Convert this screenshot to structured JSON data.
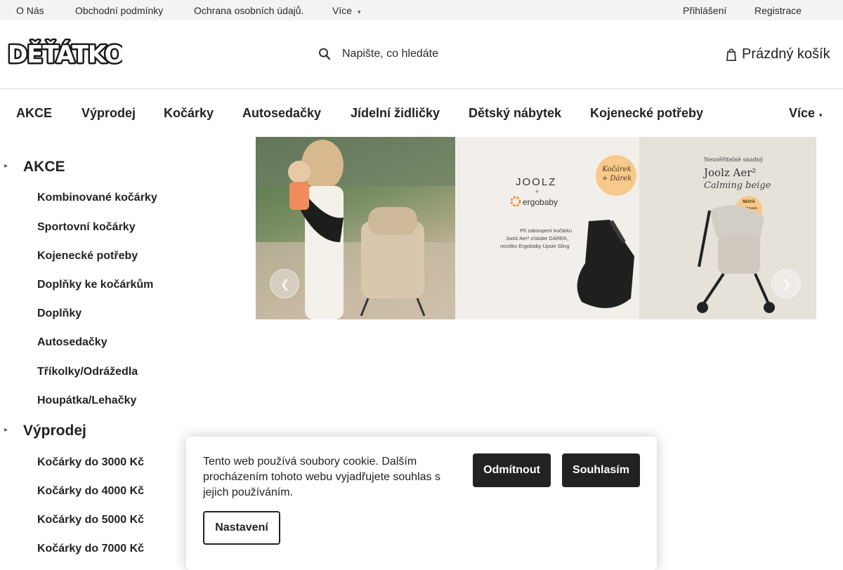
{
  "topbar": {
    "links": [
      "O Nás",
      "Obchodní podmínky",
      "Ochrana osobních údajů.",
      "Více"
    ],
    "login": "Přihlášení",
    "register": "Registrace"
  },
  "header": {
    "logo_text": "DĚŤÁTKO",
    "search_placeholder": "Napište, co hledáte",
    "cart_label": "Prázdný košík"
  },
  "mainnav": {
    "items": [
      "AKCE",
      "Výprodej",
      "Kočárky",
      "Autosedačky",
      "Jídelní židličky",
      "Dětský nábytek",
      "Kojenecké potřeby"
    ],
    "more": "Více"
  },
  "sidebar": {
    "categories": [
      {
        "label": "AKCE",
        "items": [
          "Kombinované kočárky",
          "Sportovní kočárky",
          "Kojenecké potřeby",
          "Doplňky ke kočárkům",
          "Doplňky",
          "Autosedačky",
          "Tříkolky/Odrážedla",
          "Houpátka/Lehačky"
        ]
      },
      {
        "label": "Výprodej",
        "items": [
          "Kočárky do 3000 Kč",
          "Kočárky do 4000 Kč",
          "Kočárky do 5000 Kč",
          "Kočárky do 7000 Kč"
        ]
      }
    ]
  },
  "banner": {
    "brand1": "JOOLZ",
    "plus": "+",
    "brand2": "ergobaby",
    "badge": "Kočárek + Dárek",
    "promo_lines": [
      "Při zakoupení kočárku",
      "Joolz Aer² získáte DÁREK,",
      "nosítko Ergobaby Upsie Sling"
    ],
    "right_tagline": "Neuvěřitelně snadný",
    "right_title": "Joolz Aer²",
    "right_subtitle": "Calming beige",
    "new_badge": [
      "NOVÁ",
      "Limitovaná",
      "Edice"
    ]
  },
  "cookie": {
    "message": "Tento web používá soubory cookie. Dalším procházením tohoto webu vyjadřujete souhlas s jejich používáním.",
    "decline": "Odmítnout",
    "accept": "Souhlasím",
    "settings": "Nastavení"
  },
  "colors": {
    "dark_button": "#222222",
    "topbar_bg": "#f3f3f3",
    "badge_orange": "#f7c98a"
  }
}
